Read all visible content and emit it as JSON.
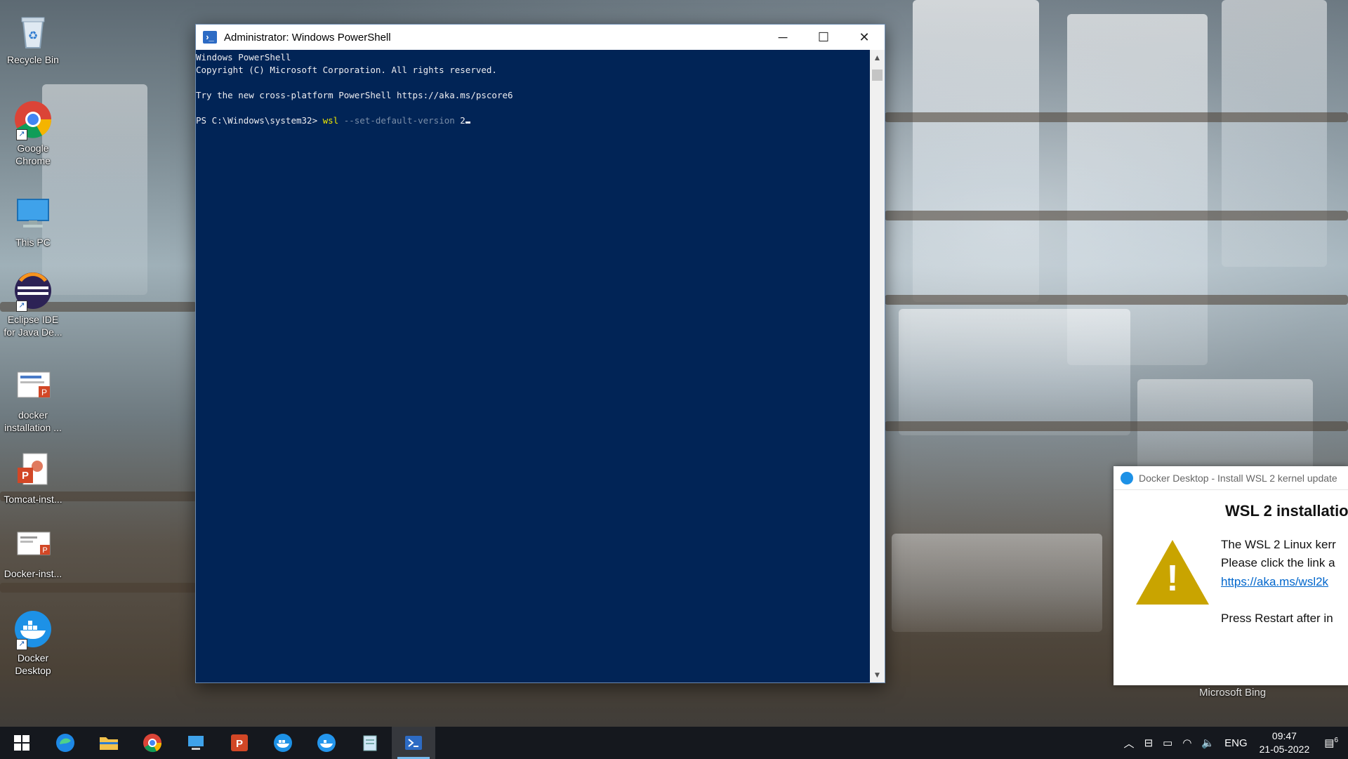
{
  "desktop": {
    "icons": [
      {
        "label": "Recycle Bin",
        "name": "recycle-bin"
      },
      {
        "label": "Google Chrome",
        "name": "google-chrome"
      },
      {
        "label": "This PC",
        "name": "this-pc"
      },
      {
        "label": "Eclipse IDE for Java De...",
        "name": "eclipse-ide"
      },
      {
        "label": "docker installation ...",
        "name": "docker-installation-doc"
      },
      {
        "label": "Tomcat-inst...",
        "name": "tomcat-install-ppt"
      },
      {
        "label": "Docker-inst...",
        "name": "docker-install-ppt"
      },
      {
        "label": "Docker Desktop",
        "name": "docker-desktop"
      }
    ],
    "watermark": "Microsoft Bing"
  },
  "powershell": {
    "title": "Administrator: Windows PowerShell",
    "lines": {
      "l1": "Windows PowerShell",
      "l2": "Copyright (C) Microsoft Corporation. All rights reserved.",
      "l3": "Try the new cross-platform PowerShell https://aka.ms/pscore6",
      "prompt": "PS C:\\Windows\\system32> ",
      "cmd": "wsl",
      "param": " --set-default-version ",
      "arg": "2"
    },
    "background": "#012456"
  },
  "notification": {
    "app": "Docker Desktop - Install WSL 2 kernel update",
    "title": "WSL 2 installatio",
    "line1": "The WSL 2 Linux kerr",
    "line2": "Please click the link a",
    "link": "https://aka.ms/wsl2k",
    "line3": "Press Restart after in"
  },
  "taskbar": {
    "apps": [
      "start",
      "edge",
      "file-explorer",
      "chrome",
      "this-pc",
      "powerpoint",
      "docker-desktop",
      "docker",
      "notepad",
      "powershell"
    ],
    "tray": {
      "lang": "ENG",
      "time": "09:47",
      "date": "21-05-2022",
      "notif_count": "6"
    }
  }
}
